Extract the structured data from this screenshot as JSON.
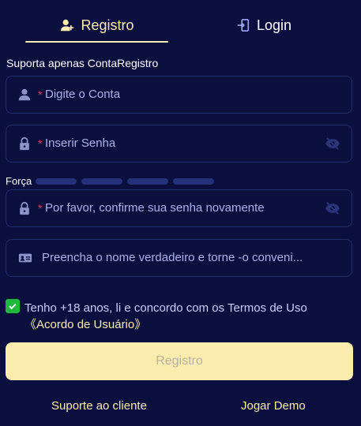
{
  "tabs": [
    {
      "label": "Registro",
      "icon": "add-user-icon",
      "active": true
    },
    {
      "label": "Login",
      "icon": "login-door-icon",
      "active": false
    }
  ],
  "form": {
    "section_label": "Suporta apenas ContaRegistro",
    "account": {
      "required_mark": "*",
      "placeholder": "Digite o Conta",
      "icon": "user-icon"
    },
    "password": {
      "required_mark": "*",
      "placeholder": "Inserir Senha",
      "icon": "lock-icon",
      "toggle_icon": "eye-off-icon"
    },
    "strength": {
      "label": "Força",
      "levels": 4
    },
    "confirm": {
      "required_mark": "*",
      "placeholder": "Por favor, confirme sua senha novamente",
      "icon": "lock-icon",
      "toggle_icon": "eye-off-icon"
    },
    "realname": {
      "placeholder": "Preencha o nome verdadeiro e torne -o conveni...",
      "icon": "id-card-icon"
    },
    "agreement": {
      "checked": true,
      "text": "Tenho +18 anos, li e concordo com os Termos de Uso",
      "link": "《Acordo de Usuário》"
    },
    "submit_label": "Registro"
  },
  "footer": {
    "support_label": "Suporte ao cliente",
    "demo_label": "Jogar Demo"
  },
  "colors": {
    "background": "#0b0f3d",
    "accent": "#fcecae",
    "field_border": "#232d6e",
    "placeholder": "#aab1e8",
    "required": "#e0334b",
    "checkbox": "#1db83a",
    "strength_bar": "#25307a"
  }
}
